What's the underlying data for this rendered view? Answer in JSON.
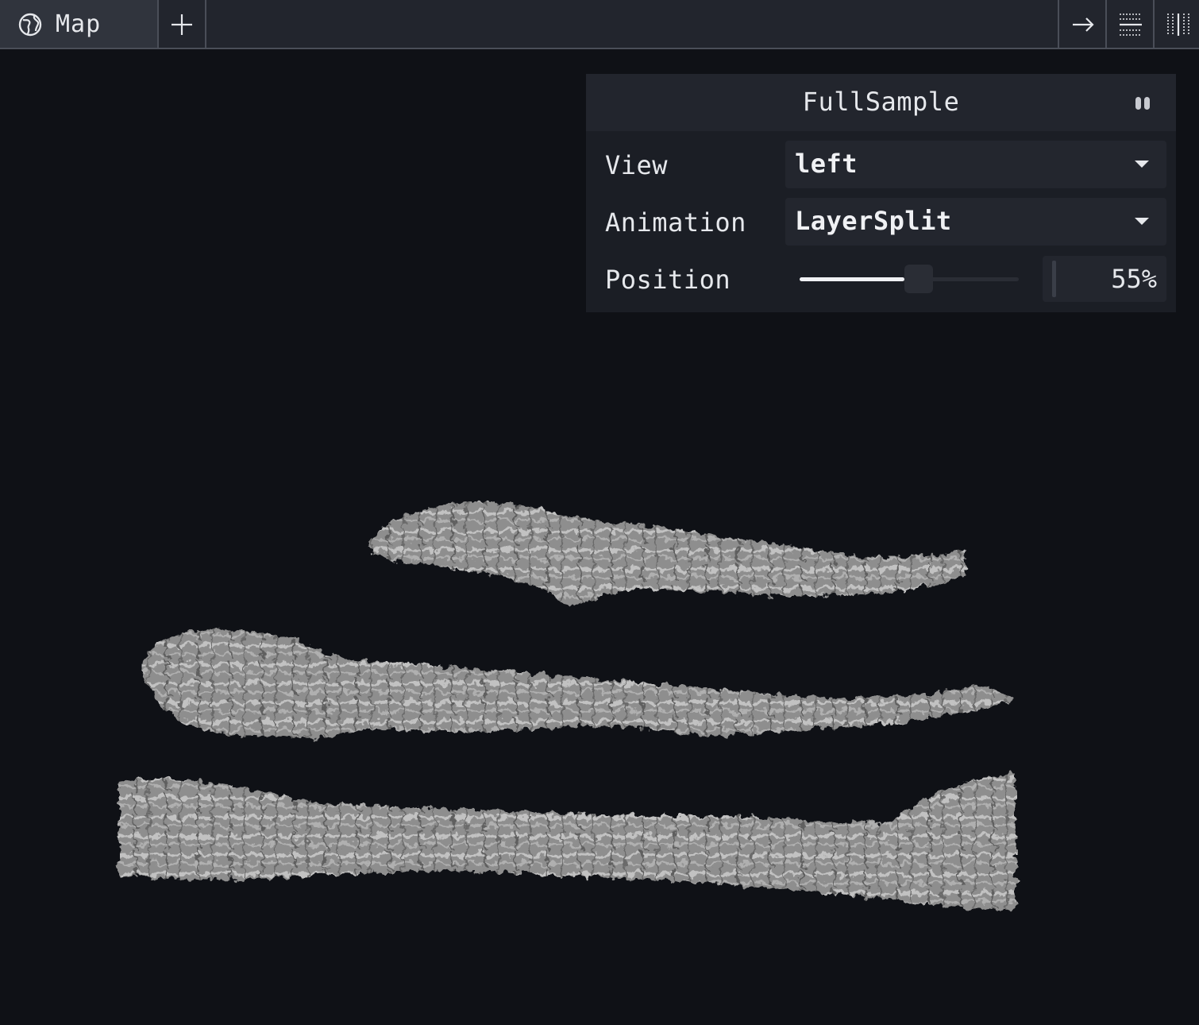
{
  "tabs": {
    "active": {
      "label": "Map",
      "icon": "globe-icon"
    },
    "add_icon": "plus-icon"
  },
  "toolbar": {
    "icons": [
      "arrow-right-icon",
      "split-horizontal-icon",
      "split-vertical-icon"
    ]
  },
  "panel": {
    "title": "FullSample",
    "rows": {
      "view": {
        "label": "View",
        "value": "left"
      },
      "animation": {
        "label": "Animation",
        "value": "LayerSplit"
      },
      "position": {
        "label": "Position",
        "value": 55,
        "display": "55%"
      }
    }
  },
  "colors": {
    "background": "#0f1116",
    "panel": "#1b1e25",
    "tabbar": "#22252d",
    "mesh": "#9a9a9a"
  }
}
